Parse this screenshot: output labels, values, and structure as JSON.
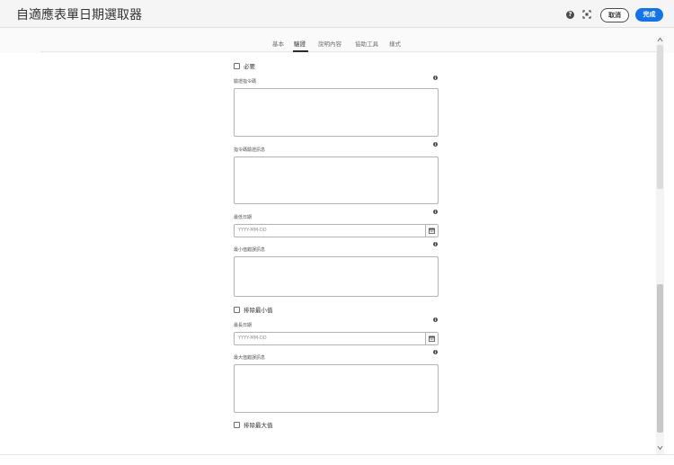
{
  "header": {
    "title": "自適應表單日期選取器",
    "cancel_label": "取消",
    "done_label": "完成",
    "help_icon": "?",
    "icons": [
      "help-icon",
      "fullscreen-icon"
    ]
  },
  "tabs": [
    {
      "label": "基本",
      "active": false
    },
    {
      "label": "驗證",
      "active": true
    },
    {
      "label": "說明內容",
      "active": false
    },
    {
      "label": "協助工具",
      "active": false
    },
    {
      "label": "樣式",
      "active": false
    }
  ],
  "form": {
    "required_label": "必要",
    "validation_script_label": "驗證指令碼",
    "required_message_label": "指令碼驗證訊息",
    "min_date_label": "最低日期",
    "min_date_placeholder": "YYYY-MM-DD",
    "min_date_message_label": "最小值錯誤訊息",
    "exclude_min_label": "排除最小值",
    "max_date_label": "最長日期",
    "max_date_placeholder": "YYYY-MM-DD",
    "max_date_message_label": "最大值錯誤訊息",
    "exclude_max_label": "排除最大值",
    "info_icon": "i"
  },
  "colors": {
    "accent": "#1473e6",
    "header_bg": "#f5f5f5",
    "border": "#b3b3b3"
  }
}
